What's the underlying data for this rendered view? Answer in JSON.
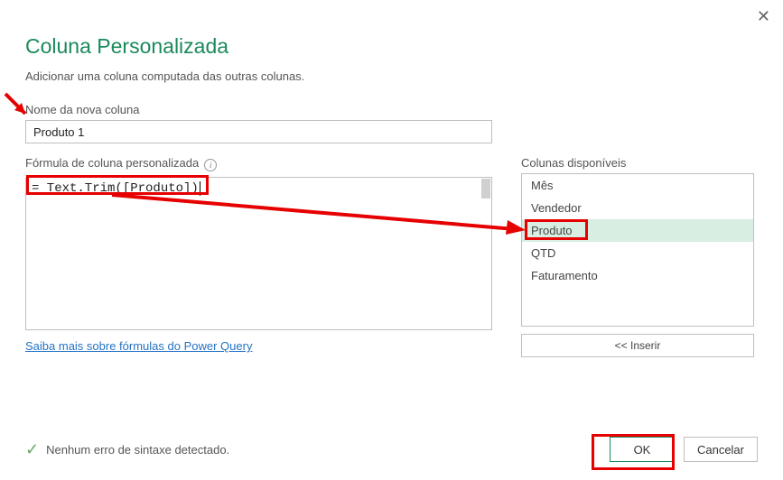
{
  "dialog": {
    "title": "Coluna Personalizada",
    "subtitle": "Adicionar uma coluna computada das outras colunas."
  },
  "new_column": {
    "label": "Nome da nova coluna",
    "value": "Produto 1"
  },
  "formula": {
    "label": "Fórmula de coluna personalizada",
    "value": "= Text.Trim([Produto])"
  },
  "available": {
    "label": "Colunas disponíveis",
    "items": [
      "Mês",
      "Vendedor",
      "Produto",
      "QTD",
      "Faturamento"
    ],
    "selected_index": 2,
    "insert_label": "<< Inserir"
  },
  "link_text": "Saiba mais sobre fórmulas do Power Query",
  "status": "Nenhum erro de sintaxe detectado.",
  "buttons": {
    "ok": "OK",
    "cancel": "Cancelar"
  }
}
